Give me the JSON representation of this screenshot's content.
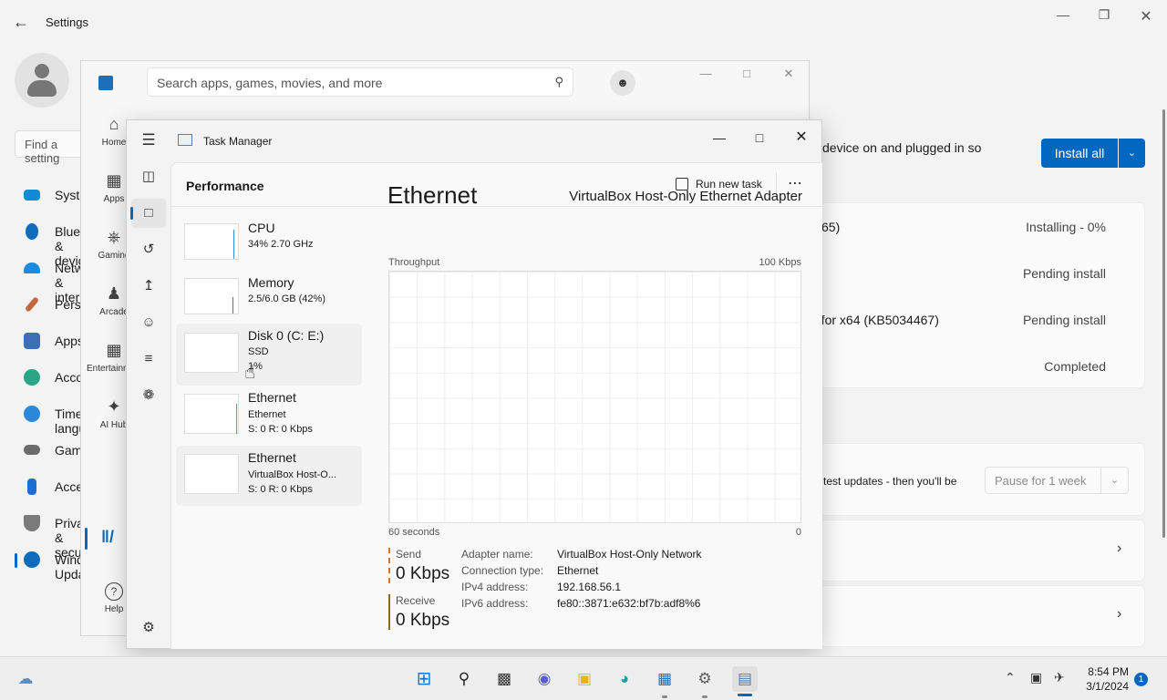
{
  "settings": {
    "title": "Settings",
    "find_placeholder": "Find a setting",
    "nav": [
      {
        "label": "System",
        "color": "#0f6cbd"
      },
      {
        "label": "Bluetooth & devices",
        "color": "#0f6cbd"
      },
      {
        "label": "Network & internet",
        "color": "#1b8be0"
      },
      {
        "label": "Personalization",
        "color": "#c2683c"
      },
      {
        "label": "Apps",
        "color": "#3b6fb6"
      },
      {
        "label": "Accounts",
        "color": "#2aa586"
      },
      {
        "label": "Time & language",
        "color": "#2b88d8"
      },
      {
        "label": "Gaming",
        "color": "#6b6b6b"
      },
      {
        "label": "Accessibility",
        "color": "#1f6fd1"
      },
      {
        "label": "Privacy & security",
        "color": "#7a7a7a"
      },
      {
        "label": "Windows Update",
        "color": "#0f6cbd"
      }
    ],
    "notice_text": "device on and plugged in so",
    "install_all": "Install all",
    "updates": [
      {
        "name": "65)",
        "status": "Installing - 0%"
      },
      {
        "name": "",
        "status": "Pending install"
      },
      {
        "name": "2 for x64 (KB5034467)",
        "status": "Pending install"
      },
      {
        "name": "",
        "status": "Completed"
      }
    ],
    "pause_text": "test updates - then you'll be",
    "pause_button": "Pause for 1 week"
  },
  "store": {
    "search_placeholder": "Search apps, games, movies, and more",
    "nav": [
      {
        "label": "Home",
        "icon": "home-icon"
      },
      {
        "label": "Apps",
        "icon": "apps-icon"
      },
      {
        "label": "Gaming",
        "icon": "gaming-icon"
      },
      {
        "label": "Arcade",
        "icon": "arcade-icon"
      },
      {
        "label": "Entertainment",
        "icon": "entertainment-icon"
      },
      {
        "label": "AI Hub",
        "icon": "ai-hub-icon"
      },
      {
        "label": "Help",
        "icon": "help-icon"
      }
    ]
  },
  "task_manager": {
    "title": "Task Manager",
    "page_title": "Performance",
    "run_new_task": "Run new task",
    "items": [
      {
        "name": "CPU",
        "line1": "34% 2.70 GHz",
        "line2": ""
      },
      {
        "name": "Memory",
        "line1": "2.5/6.0 GB (42%)",
        "line2": ""
      },
      {
        "name": "Disk 0 (C: E:)",
        "line1": "SSD",
        "line2": "1%"
      },
      {
        "name": "Ethernet",
        "line1": "Ethernet",
        "line2": "S: 0 R: 0 Kbps"
      },
      {
        "name": "Ethernet",
        "line1": "VirtualBox Host-O...",
        "line2": "S: 0 R: 0 Kbps"
      }
    ],
    "detail": {
      "title": "Ethernet",
      "adapter": "VirtualBox Host-Only Ethernet Adapter",
      "graph_label": "Throughput",
      "graph_max": "100 Kbps",
      "graph_time": "60 seconds",
      "graph_min": "0",
      "send_label": "Send",
      "send_value": "0 Kbps",
      "receive_label": "Receive",
      "receive_value": "0 Kbps",
      "info": [
        {
          "key": "Adapter name:",
          "value": "VirtualBox Host-Only Network"
        },
        {
          "key": "Connection type:",
          "value": "Ethernet"
        },
        {
          "key": "IPv4 address:",
          "value": "192.168.56.1"
        },
        {
          "key": "IPv6 address:",
          "value": "fe80::3871:e632:bf7b:adf8%6"
        }
      ]
    }
  },
  "taskbar": {
    "time": "8:54 PM",
    "date": "3/1/2024",
    "notification_count": "1"
  },
  "colors": {
    "accent": "#0067c0",
    "send_line": "#c87832",
    "receive_line": "#8a6a1e"
  }
}
